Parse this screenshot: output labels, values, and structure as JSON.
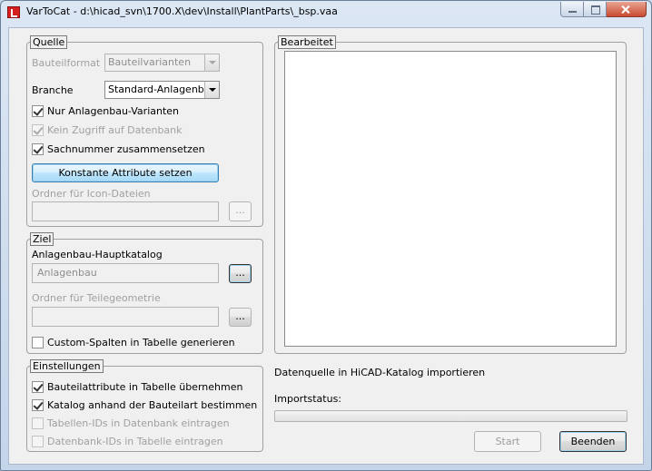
{
  "window": {
    "title": "VarToCat - d:\\hicad_svn\\1700.X\\dev\\Install\\PlantParts\\_bsp.vaa"
  },
  "quelle": {
    "title": "Quelle",
    "bauteilformat_label": "Bauteilformat",
    "bauteilformat_value": "Bauteilvarianten",
    "branche_label": "Branche",
    "branche_value": "Standard-Anlagenbau",
    "nur_anlagenbau": {
      "label": "Nur Anlagenbau-Varianten",
      "checked": true,
      "enabled": true
    },
    "kein_zugriff": {
      "label": "Kein Zugriff auf Datenbank",
      "checked": true,
      "enabled": false
    },
    "sachnummer": {
      "label": "Sachnummer zusammensetzen",
      "checked": true,
      "enabled": true
    },
    "konstante_button": "Konstante Attribute setzen",
    "icon_folder_label": "Ordner für Icon-Dateien",
    "icon_folder_value": "",
    "browse_label": "..."
  },
  "ziel": {
    "title": "Ziel",
    "hauptkatalog_label": "Anlagenbau-Hauptkatalog",
    "hauptkatalog_value": "Anlagenbau",
    "browse_label": "...",
    "teilegeometrie_label": "Ordner für Teilegeometrie",
    "teilegeometrie_value": "",
    "browse2_label": "...",
    "custom_spalten": {
      "label": "Custom-Spalten in Tabelle generieren",
      "checked": false,
      "enabled": true
    }
  },
  "einstellungen": {
    "title": "Einstellungen",
    "bauteilattribute": {
      "label": "Bauteilattribute in Tabelle übernehmen",
      "checked": true,
      "enabled": true
    },
    "katalog_bauteilart": {
      "label": "Katalog anhand der Bauteilart bestimmen",
      "checked": true,
      "enabled": true
    },
    "tabellen_ids": {
      "label": "Tabellen-IDs in Datenbank eintragen",
      "checked": false,
      "enabled": false
    },
    "datenbank_ids": {
      "label": "Datenbank-IDs in Tabelle eintragen",
      "checked": false,
      "enabled": false
    }
  },
  "bearbeitet": {
    "title": "Bearbeitet",
    "items": []
  },
  "status": {
    "datenquelle_text": "Datenquelle in HiCAD-Katalog importieren",
    "importstatus_label": "Importstatus:",
    "progress": 0
  },
  "buttons": {
    "start": "Start",
    "beenden": "Beenden"
  }
}
